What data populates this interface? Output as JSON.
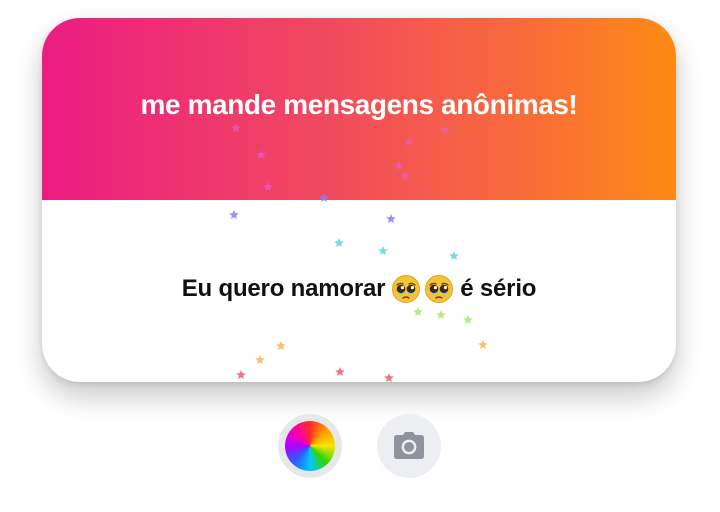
{
  "card": {
    "title": "me mande mensagens anônimas!",
    "message_text": "Eu quero namorar",
    "message_emoji_count": 2,
    "message_suffix": "é sério",
    "header_gradient": [
      "#ec1c82",
      "#fd8a14"
    ]
  },
  "controls": {
    "color_button_icon": "color-wheel-icon",
    "camera_button_icon": "camera-icon"
  },
  "decor": {
    "star_colors": [
      "#e95bb8",
      "#8b7cf0",
      "#5ad7e0",
      "#a8e86c",
      "#f7b25a",
      "#f05a6b"
    ]
  }
}
